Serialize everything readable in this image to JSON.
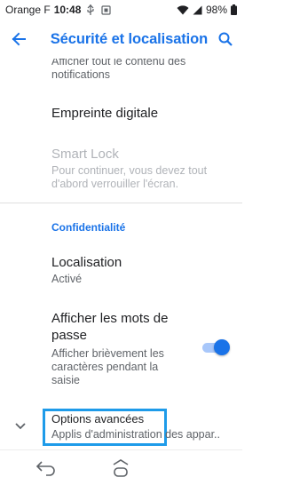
{
  "status_bar": {
    "carrier": "Orange F",
    "time": "10:48",
    "battery": "98%"
  },
  "toolbar": {
    "title": "Sécurité et localisation"
  },
  "items": {
    "lockscreen_summary": "Afficher tout le contenu des notifications",
    "fingerprint_label": "Empreinte digitale",
    "smart_lock_label": "Smart Lock",
    "smart_lock_summary": "Pour continuer, vous devez tout d'abord verrouiller l'écran.",
    "privacy_category": "Confidentialité",
    "location_label": "Localisation",
    "location_summary": "Activé",
    "show_passwords_label": "Afficher les mots de passe",
    "show_passwords_summary": "Afficher brièvement les caractères pendant la saisie",
    "show_passwords_enabled": true
  },
  "advanced": {
    "title": "Options avancées",
    "summary": "Applis d'administration des appar.."
  },
  "colors": {
    "accent": "#1a73e8",
    "highlight_box": "#1e9be9"
  }
}
